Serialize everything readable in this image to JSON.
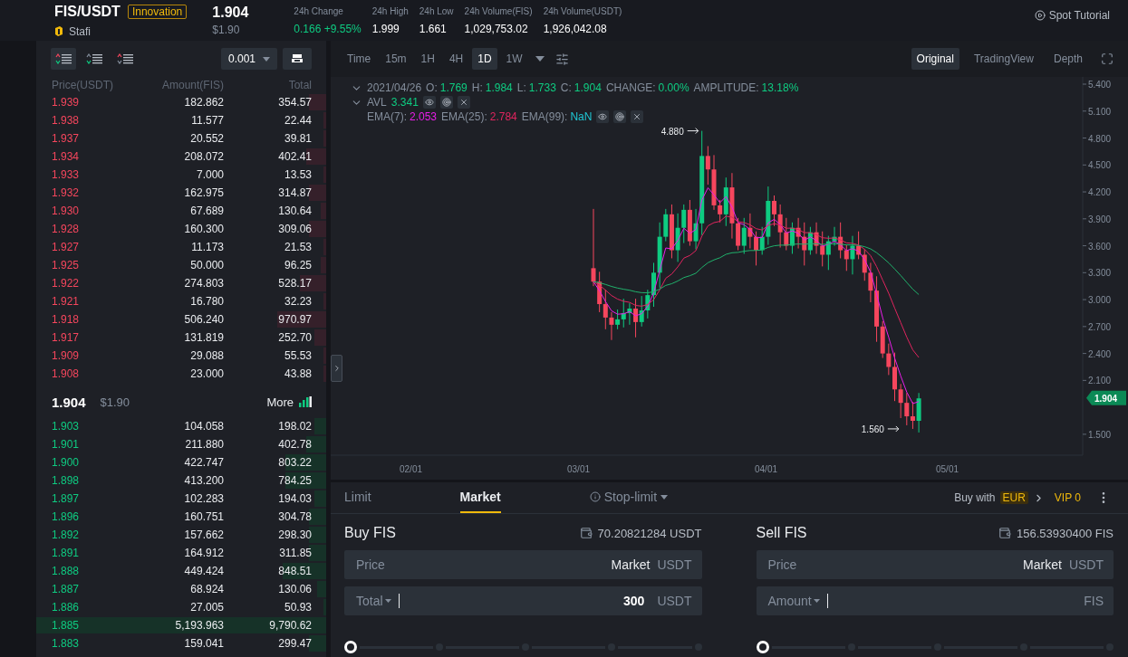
{
  "header": {
    "symbol": "FIS/USDT",
    "tag": "Innovation",
    "project": "Stafi",
    "price": "1.904",
    "price_usd": "$1.90",
    "stats": [
      {
        "label": "24h Change",
        "value": "0.166 +9.55%",
        "kind": "change"
      },
      {
        "label": "24h High",
        "value": "1.999",
        "kind": "plain"
      },
      {
        "label": "24h Low",
        "value": "1.661",
        "kind": "plain"
      },
      {
        "label": "24h Volume(FIS)",
        "value": "1,029,753.02",
        "kind": "plain"
      },
      {
        "label": "24h Volume(USDT)",
        "value": "1,926,042.08",
        "kind": "plain"
      }
    ],
    "tutorial": "Spot Tutorial"
  },
  "order_book": {
    "views": [
      {
        "kind": "both",
        "selected": true
      },
      {
        "kind": "bids",
        "selected": false
      },
      {
        "kind": "asks",
        "selected": false
      }
    ],
    "precision": "0.001",
    "columns": [
      "Price(USDT)",
      "Amount(FIS)",
      "Total"
    ],
    "asks": [
      {
        "price": "1.939",
        "amount": "182.862",
        "total": "354.57",
        "level": 0.06
      },
      {
        "price": "1.938",
        "amount": "11.577",
        "total": "22.44",
        "level": 0.01
      },
      {
        "price": "1.937",
        "amount": "20.552",
        "total": "39.81",
        "level": 0.01
      },
      {
        "price": "1.934",
        "amount": "208.072",
        "total": "402.41",
        "level": 0.07
      },
      {
        "price": "1.933",
        "amount": "7.000",
        "total": "13.53",
        "level": 0.01
      },
      {
        "price": "1.932",
        "amount": "162.975",
        "total": "314.87",
        "level": 0.06
      },
      {
        "price": "1.930",
        "amount": "67.689",
        "total": "130.64",
        "level": 0.02
      },
      {
        "price": "1.928",
        "amount": "160.300",
        "total": "309.06",
        "level": 0.06
      },
      {
        "price": "1.927",
        "amount": "11.173",
        "total": "21.53",
        "level": 0.01
      },
      {
        "price": "1.925",
        "amount": "50.000",
        "total": "96.25",
        "level": 0.02
      },
      {
        "price": "1.922",
        "amount": "274.803",
        "total": "528.17",
        "level": 0.09
      },
      {
        "price": "1.921",
        "amount": "16.780",
        "total": "32.23",
        "level": 0.01
      },
      {
        "price": "1.918",
        "amount": "506.240",
        "total": "970.97",
        "level": 0.17
      },
      {
        "price": "1.917",
        "amount": "131.819",
        "total": "252.70",
        "level": 0.04
      },
      {
        "price": "1.909",
        "amount": "29.088",
        "total": "55.53",
        "level": 0.01
      },
      {
        "price": "1.908",
        "amount": "23.000",
        "total": "43.88",
        "level": 0.01
      }
    ],
    "last_price": "1.904",
    "last_usd": "$1.90",
    "more": "More",
    "bids": [
      {
        "price": "1.903",
        "amount": "104.058",
        "total": "198.02",
        "level": 0.04
      },
      {
        "price": "1.901",
        "amount": "211.880",
        "total": "402.78",
        "level": 0.07
      },
      {
        "price": "1.900",
        "amount": "422.747",
        "total": "803.22",
        "level": 0.14
      },
      {
        "price": "1.898",
        "amount": "413.200",
        "total": "784.25",
        "level": 0.14
      },
      {
        "price": "1.897",
        "amount": "102.283",
        "total": "194.03",
        "level": 0.04
      },
      {
        "price": "1.896",
        "amount": "160.751",
        "total": "304.78",
        "level": 0.06
      },
      {
        "price": "1.892",
        "amount": "157.662",
        "total": "298.30",
        "level": 0.06
      },
      {
        "price": "1.891",
        "amount": "164.912",
        "total": "311.85",
        "level": 0.06
      },
      {
        "price": "1.888",
        "amount": "449.424",
        "total": "848.51",
        "level": 0.15
      },
      {
        "price": "1.887",
        "amount": "68.924",
        "total": "130.06",
        "level": 0.03
      },
      {
        "price": "1.886",
        "amount": "27.005",
        "total": "50.93",
        "level": 0.01
      },
      {
        "price": "1.885",
        "amount": "5,193.963",
        "total": "9,790.62",
        "level": 1
      },
      {
        "price": "1.883",
        "amount": "159.041",
        "total": "299.47",
        "level": 0.06
      }
    ]
  },
  "chart": {
    "intervals": [
      {
        "label": "Time",
        "selected": false
      },
      {
        "label": "15m",
        "selected": false
      },
      {
        "label": "1H",
        "selected": false
      },
      {
        "label": "4H",
        "selected": false
      },
      {
        "label": "1D",
        "selected": true
      },
      {
        "label": "1W",
        "selected": false
      }
    ],
    "views": [
      {
        "label": "Original",
        "selected": true
      },
      {
        "label": "TradingView",
        "selected": false
      },
      {
        "label": "Depth",
        "selected": false
      }
    ],
    "legend": {
      "date": "2021/04/26",
      "ohlc": [
        {
          "label": "O:",
          "value": "1.769"
        },
        {
          "label": "H:",
          "value": "1.984"
        },
        {
          "label": "L:",
          "value": "1.733"
        },
        {
          "label": "C:",
          "value": "1.904"
        },
        {
          "label": "CHANGE:",
          "value": "0.00%"
        },
        {
          "label": "AMPLITUDE:",
          "value": "13.18%"
        }
      ],
      "volume_label": "AVL",
      "volume": "3.341",
      "emas": [
        {
          "label": "EMA(7):",
          "value": "2.053",
          "color": "#e91ee9"
        },
        {
          "label": "EMA(25):",
          "value": "2.784",
          "color": "#e0245e"
        },
        {
          "label": "EMA(99):",
          "value": "NaN",
          "color": "#1fc7d4"
        }
      ]
    },
    "y_ticks": [
      "5.400",
      "5.100",
      "4.800",
      "4.500",
      "4.200",
      "3.900",
      "3.600",
      "3.300",
      "3.000",
      "2.700",
      "2.400",
      "2.100",
      "1.500"
    ],
    "x_ticks": [
      "02/01",
      "03/01",
      "04/01",
      "05/01"
    ],
    "high_marker": "4.880",
    "low_marker": "1.560",
    "price_tag": "1.904"
  },
  "trade": {
    "tabs": [
      {
        "label": "Limit",
        "selected": false,
        "kind": "plain"
      },
      {
        "label": "Market",
        "selected": true,
        "kind": "plain"
      },
      {
        "label": "Stop-limit",
        "selected": false,
        "kind": "dropdown"
      }
    ],
    "buy_with": "Buy with",
    "currency": "EUR",
    "vip": "VIP 0",
    "panels": [
      {
        "title": "Buy FIS",
        "balance": "70.20821284 USDT",
        "price_label": "Price",
        "price_value": "Market",
        "price_unit": "USDT",
        "amount_label": "Total",
        "amount_value": "300",
        "amount_unit": "USDT",
        "level": 0
      },
      {
        "title": "Sell FIS",
        "balance": "156.53930400 FIS",
        "price_label": "Price",
        "price_value": "Market",
        "price_unit": "USDT",
        "amount_label": "Amount",
        "amount_unit": "FIS",
        "level": 0
      }
    ]
  }
}
